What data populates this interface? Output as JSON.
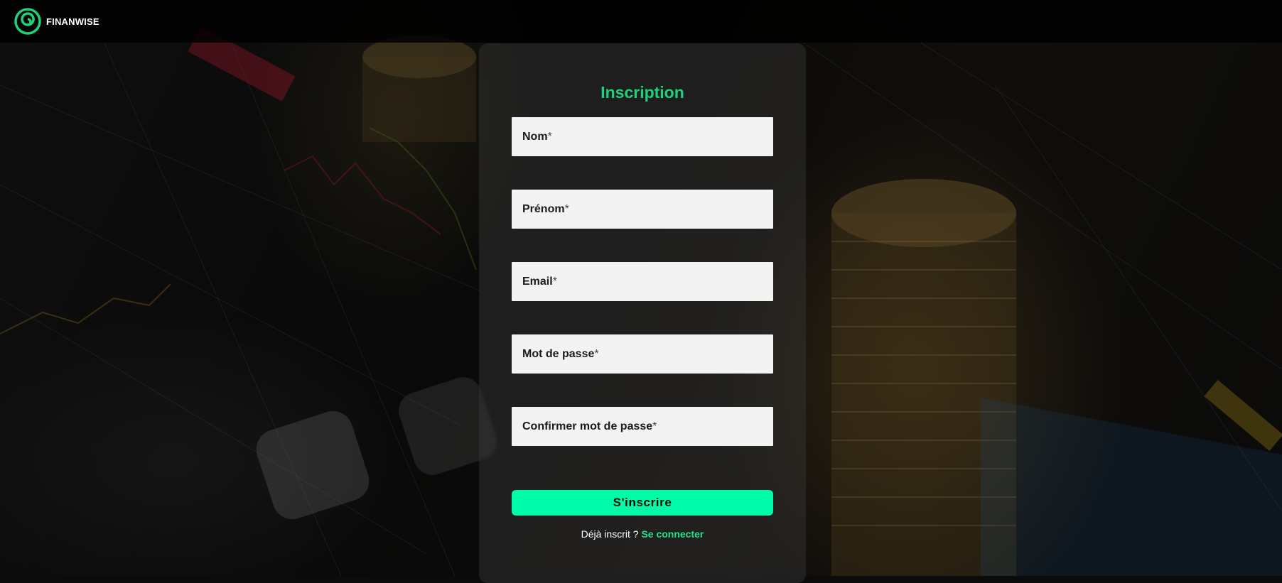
{
  "brand": {
    "name": "FINANWISE",
    "logo_icon": "finanwise-logo-icon",
    "accent": "#1fd17a"
  },
  "form": {
    "title": "Inscription",
    "fields": [
      {
        "label": "Nom",
        "required_mark": "*"
      },
      {
        "label": "Prénom",
        "required_mark": "*"
      },
      {
        "label": "Email",
        "required_mark": "*"
      },
      {
        "label": "Mot de passe",
        "required_mark": "*"
      },
      {
        "label": "Confirmer mot de passe",
        "required_mark": "*"
      }
    ],
    "submit_label": "S'inscrire",
    "submit_color": "#00fca8",
    "login_prompt": "Déjà inscrit ?",
    "login_link": "Se connecter"
  }
}
